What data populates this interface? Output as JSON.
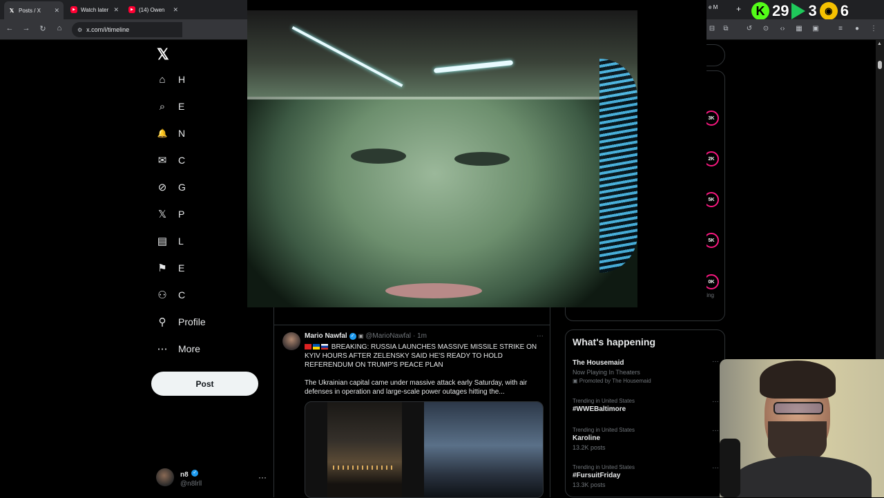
{
  "browser": {
    "tabs": [
      {
        "title": "Posts / X",
        "icon": "x-logo-icon"
      },
      {
        "title": "Watch later",
        "icon": "youtube-icon"
      },
      {
        "title": "(14) Owen",
        "icon": "youtube-icon"
      }
    ],
    "url": "x.com/i/timeline",
    "partial_tab_text": "e M"
  },
  "stream_overlay": {
    "kick_count": "29",
    "play_count": "3",
    "crown_count": "6"
  },
  "sidebar": {
    "items": [
      {
        "label": "H",
        "icon": "home-icon",
        "glyph": "⌂"
      },
      {
        "label": "E",
        "icon": "search-icon",
        "glyph": "⌕"
      },
      {
        "label": "N",
        "icon": "bell-icon",
        "glyph": "🔔"
      },
      {
        "label": "C",
        "icon": "mail-icon",
        "glyph": "✉"
      },
      {
        "label": "G",
        "icon": "grok-icon",
        "glyph": "⊘"
      },
      {
        "label": "P",
        "icon": "x-premium-icon",
        "glyph": "𝕏"
      },
      {
        "label": "L",
        "icon": "lists-icon",
        "glyph": "▤"
      },
      {
        "label": "E",
        "icon": "bookmark-icon",
        "glyph": "⚑"
      },
      {
        "label": "C",
        "icon": "communities-icon",
        "glyph": "⚇"
      },
      {
        "label": "Profile",
        "icon": "profile-icon",
        "glyph": "⚲"
      },
      {
        "label": "More",
        "icon": "more-icon",
        "glyph": "⋯"
      }
    ],
    "post_label": "Post",
    "user": {
      "name": "n8",
      "handle": "@n8lrll"
    }
  },
  "post": {
    "author": "Mario Nawfal",
    "handle": "@MarioNawfal",
    "time": "· 1m",
    "headline": "BREAKING: RUSSIA LAUNCHES MASSIVE MISSILE STRIKE ON KYIV HOURS AFTER ZELENSKY SAID HE'S READY TO HOLD REFERENDUM ON TRUMP'S PEACE PLAN",
    "body": "The Ukrainian capital came under massive attack early Saturday, with air defenses in operation and large-scale power outages hitting the..."
  },
  "right": {
    "rings": [
      "3K",
      "2K",
      "5K",
      "5K",
      "0K"
    ],
    "ting_text": "ting",
    "happening_title": "What's happening",
    "trends": [
      {
        "meta": "",
        "title": "The Housemaid",
        "sub": "Now Playing In Theaters",
        "promo": "Promoted by The Housemaid"
      },
      {
        "meta": "Trending in United States",
        "title": "#WWEBaltimore",
        "sub": "",
        "promo": ""
      },
      {
        "meta": "Trending in United States",
        "title": "Karoline",
        "sub": "13.2K posts",
        "promo": ""
      },
      {
        "meta": "Trending in United States",
        "title": "#FursuitFriday",
        "sub": "13.3K posts",
        "promo": ""
      }
    ]
  },
  "colors": {
    "accent": "#1d9bf0",
    "kick": "#53fc18",
    "ring": "#f91880"
  }
}
